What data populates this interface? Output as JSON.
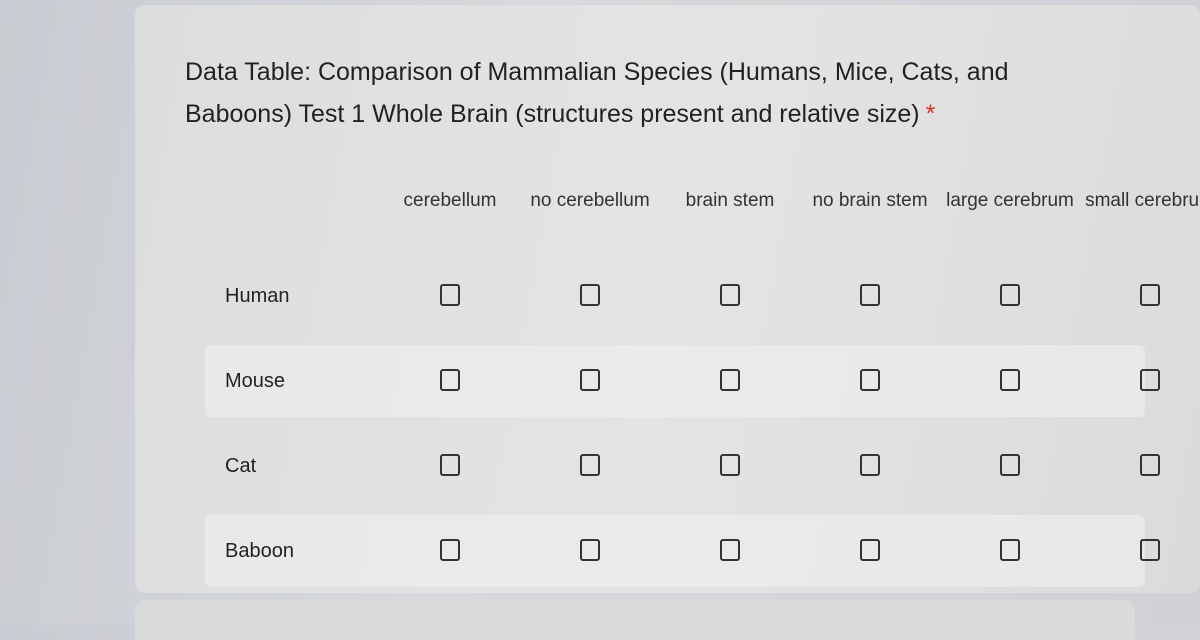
{
  "question": {
    "title": "Data Table: Comparison of Mammalian Species (Humans, Mice, Cats, and Baboons) Test 1 Whole Brain (structures present and relative size)",
    "required_marker": "*",
    "required_color": "#d93025"
  },
  "columns": [
    {
      "label": "cerebellum"
    },
    {
      "label": "no cerebellum"
    },
    {
      "label": "brain stem"
    },
    {
      "label": "no brain stem"
    },
    {
      "label": "large cerebrum"
    },
    {
      "label": "small cerebrum"
    }
  ],
  "rows": [
    {
      "label": "Human",
      "checked": [
        false,
        false,
        false,
        false,
        false,
        false
      ]
    },
    {
      "label": "Mouse",
      "checked": [
        false,
        false,
        false,
        false,
        false,
        false
      ]
    },
    {
      "label": "Cat",
      "checked": [
        false,
        false,
        false,
        false,
        false,
        false
      ]
    },
    {
      "label": "Baboon",
      "checked": [
        false,
        false,
        false,
        false,
        false,
        false
      ]
    }
  ]
}
